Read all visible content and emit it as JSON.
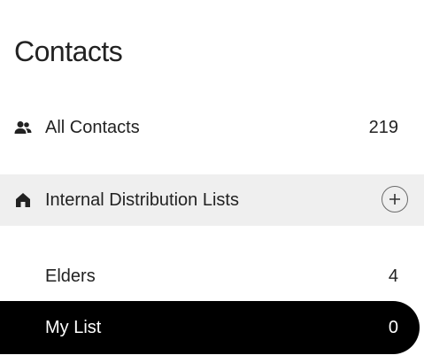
{
  "page": {
    "title": "Contacts"
  },
  "nav": {
    "all_contacts": {
      "label": "All Contacts",
      "count": "219",
      "icon": "people-icon"
    },
    "internal_lists": {
      "label": "Internal Distribution Lists",
      "icon": "home-icon",
      "add_icon": "plus-circle-icon"
    },
    "lists": [
      {
        "label": "Elders",
        "count": "4",
        "selected": false
      },
      {
        "label": "My List",
        "count": "0",
        "selected": true
      }
    ]
  },
  "colors": {
    "selected_bg": "#000000",
    "selected_text": "#ffffff",
    "section_bg": "#efefef",
    "text": "#222222"
  }
}
